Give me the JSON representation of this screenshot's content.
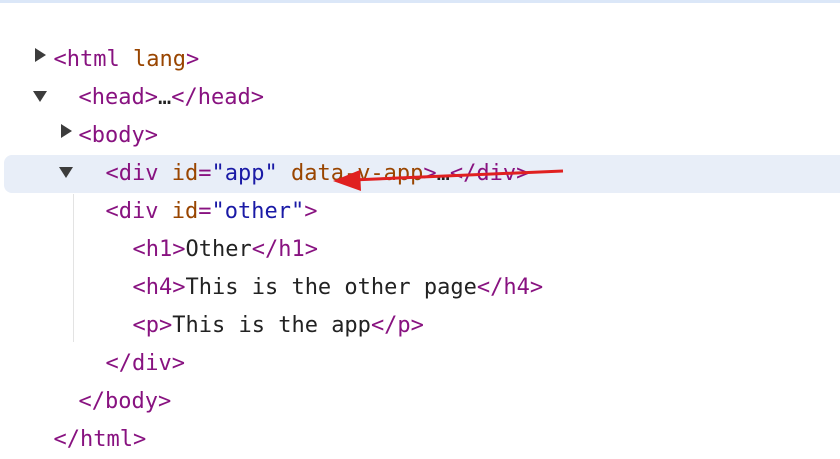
{
  "tree": {
    "html_open": {
      "tag": "<html",
      "attr_name": " lang",
      "close": ">"
    },
    "head": {
      "open": "<head>",
      "ellipsis": "…",
      "close": "</head>"
    },
    "body_open": "<body>",
    "div_app": {
      "open_start": "<div",
      "attr1_name": " id",
      "eq1": "=",
      "attr1_value": "\"app\"",
      "attr2_name": " data-v-app",
      "open_end": ">",
      "ellipsis": "…",
      "close": "</div>"
    },
    "div_other": {
      "open_start": "<div",
      "attr_name": " id",
      "eq": "=",
      "attr_value": "\"other\"",
      "open_end": ">"
    },
    "h1": {
      "open": "<h1>",
      "text": "Other",
      "close": "</h1>"
    },
    "h4": {
      "open": "<h4>",
      "text": "This is the other page",
      "close": "</h4>"
    },
    "p": {
      "open": "<p>",
      "text": "This is the app",
      "close": "</p>"
    },
    "div_close": "</div>",
    "body_close": "</body>",
    "html_close": "</html>"
  },
  "annotation": {
    "arrow_color": "#e02020"
  }
}
